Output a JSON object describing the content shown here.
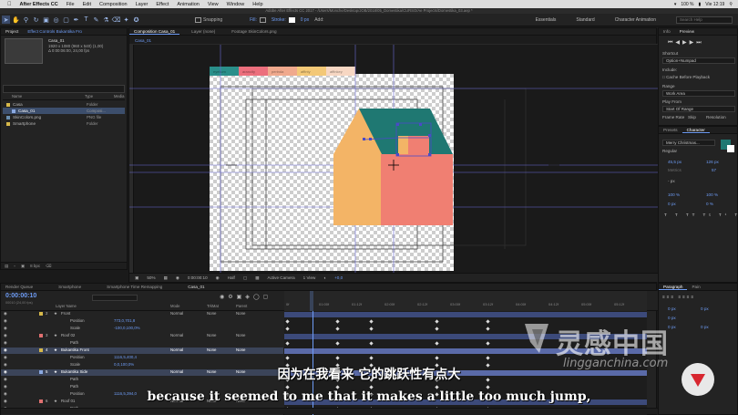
{
  "menubar": {
    "app": "After Effects CC",
    "items": [
      "File",
      "Edit",
      "Composition",
      "Layer",
      "Effect",
      "Animation",
      "View",
      "Window",
      "Help"
    ],
    "battery": "100 %",
    "clock": "Vie 12:19"
  },
  "window_title": "Adobe After Effects CC 2017 - /Users/Monche/Desktop/JOB/2018/05_Domestika/CURSO/Ae Projects/Domestika_03.aep *",
  "toolbar": {
    "snapping": "Snapping",
    "fill": "Fill:",
    "stroke": "Stroke:",
    "stroke_width": "0 px",
    "add": "Add:",
    "workspaces": [
      "Essentials",
      "Standard",
      "Character Animation"
    ],
    "search_placeholder": "Search Help"
  },
  "project": {
    "tabs": [
      "Project",
      "Effect Controls Bukantika Fro"
    ],
    "selected_name": "Casa_01",
    "info_line1": "1920 x 1080 (960 x 540) (1,00)",
    "info_line2": "Δ 0:00:06:00, 24,00 fps",
    "col_name": "Name",
    "col_type": "Type",
    "col_media": "Media",
    "items": [
      {
        "name": "Casa",
        "type": "Folder",
        "color": "#d6b84a",
        "indent": 0
      },
      {
        "name": "Casa_01",
        "type": "Composi...",
        "color": "#8aa8e0",
        "indent": 6,
        "selected": true
      },
      {
        "name": "SkinColors.png",
        "type": "PNG file",
        "color": "#6a8fb0",
        "indent": 0
      },
      {
        "name": "Smartphone",
        "type": "Folder",
        "color": "#d6b84a",
        "indent": 0
      }
    ],
    "footer": "8 bpc"
  },
  "comp_panel": {
    "tabs": [
      "Composition Casa_01",
      "Layer (none)",
      "Footage SkinColors.png"
    ],
    "sub_tab": "Casa_01",
    "footer": {
      "zoom": "50%",
      "time": "0:00:00:10",
      "resolution": "Half",
      "camera": "Active Camera",
      "views": "1 View",
      "offset": "+0,0"
    },
    "palette": [
      {
        "color": "#2a8f8a",
        "label": "eyellum"
      },
      {
        "color": "#ec6f7d",
        "label": "arancity"
      },
      {
        "color": "#f0a98d",
        "label": "perinda"
      },
      {
        "color": "#f3c877",
        "label": "affinty"
      },
      {
        "color": "#f7d7c3",
        "label": "affinkey"
      }
    ]
  },
  "info_panel": {
    "tabs": [
      "Info",
      "Preview"
    ],
    "shortcut_label": "Shortcut",
    "shortcut_value": "Option+Numpad",
    "include": "Include:",
    "cache": "Cache Before Playback",
    "range_label": "Range",
    "range_value": "Work Area",
    "play_from_label": "Play From",
    "play_from_value": "Start Of Range",
    "frame_rate": "Frame Rate",
    "skip": "Skip",
    "resolution": "Resolution"
  },
  "character_panel": {
    "tabs": [
      "Presets",
      "Character"
    ],
    "font": "Merry Christmas...",
    "style": "Regular",
    "size": "45,5 px",
    "leading": "126 px",
    "kerning": "Metrics",
    "tracking": "57",
    "stroke": "- px",
    "v_scale": "100 %",
    "h_scale": "100 %",
    "baseline": "0 px",
    "tsume": "0 %"
  },
  "paragraph_panel": {
    "tabs": [
      "Paragraph",
      "Pain"
    ],
    "indent_left": "0 px",
    "indent_first": "0 px",
    "indent_right": "0 px",
    "space_before": "0 px",
    "space_after": "0 px"
  },
  "timeline": {
    "tabs": [
      "Render Queue",
      "Smartphone",
      "Smartphone Time Remapping",
      "Casa_01"
    ],
    "timecode": "0:00:00:10",
    "fps": "00010 (24,00 fps)",
    "columns": {
      "layer_name": "Layer Name",
      "mode": "Mode",
      "trkmat": "TrkMat",
      "parent": "Parent"
    },
    "ruler": [
      "0f",
      "01:00f",
      "01:12f",
      "02:00f",
      "02:12f",
      "03:00f",
      "03:12f",
      "04:00f",
      "04:12f",
      "05:00f",
      "05:12f"
    ],
    "layers": [
      {
        "num": "2",
        "name": "Front",
        "kind": "layer",
        "mode": "Normal",
        "trk": "None",
        "parent": "None",
        "color": "#d6b84a"
      },
      {
        "name": "Position",
        "value": "773,0,701,8",
        "kind": "prop"
      },
      {
        "name": "Scale",
        "value": "-100,0,100,0%",
        "kind": "prop"
      },
      {
        "num": "3",
        "name": "Roof 02",
        "kind": "layer",
        "mode": "Normal",
        "trk": "None",
        "parent": "None",
        "color": "#e07070"
      },
      {
        "name": "Path",
        "kind": "prop"
      },
      {
        "num": "4",
        "name": "Bukantika Front",
        "kind": "layer",
        "mode": "Normal",
        "trk": "None",
        "parent": "None",
        "color": "#d6b84a",
        "selected": true
      },
      {
        "name": "Position",
        "value": "1116,5,400,4",
        "kind": "prop"
      },
      {
        "name": "Scale",
        "value": "0,0,100,0%",
        "kind": "prop"
      },
      {
        "num": "5",
        "name": "Bukantika Side",
        "kind": "layer",
        "mode": "Normal",
        "trk": "None",
        "parent": "None",
        "color": "#8aa8e0",
        "selected": true
      },
      {
        "name": "Path",
        "kind": "prop"
      },
      {
        "name": "Path",
        "kind": "prop"
      },
      {
        "name": "Position",
        "value": "1116,5,394,0",
        "kind": "prop"
      },
      {
        "num": "6",
        "name": "Roof 01",
        "kind": "layer",
        "mode": "Normal",
        "trk": "None",
        "parent": "None",
        "color": "#e07070"
      },
      {
        "name": "Path",
        "kind": "prop"
      }
    ]
  },
  "subtitles": {
    "cn": "因为在我看来 它的跳跃性有点大",
    "en": "because it seemed to me that it makes a little too much jump,"
  },
  "watermark": {
    "cn": "灵感中国",
    "en": "lingganchina.com"
  }
}
